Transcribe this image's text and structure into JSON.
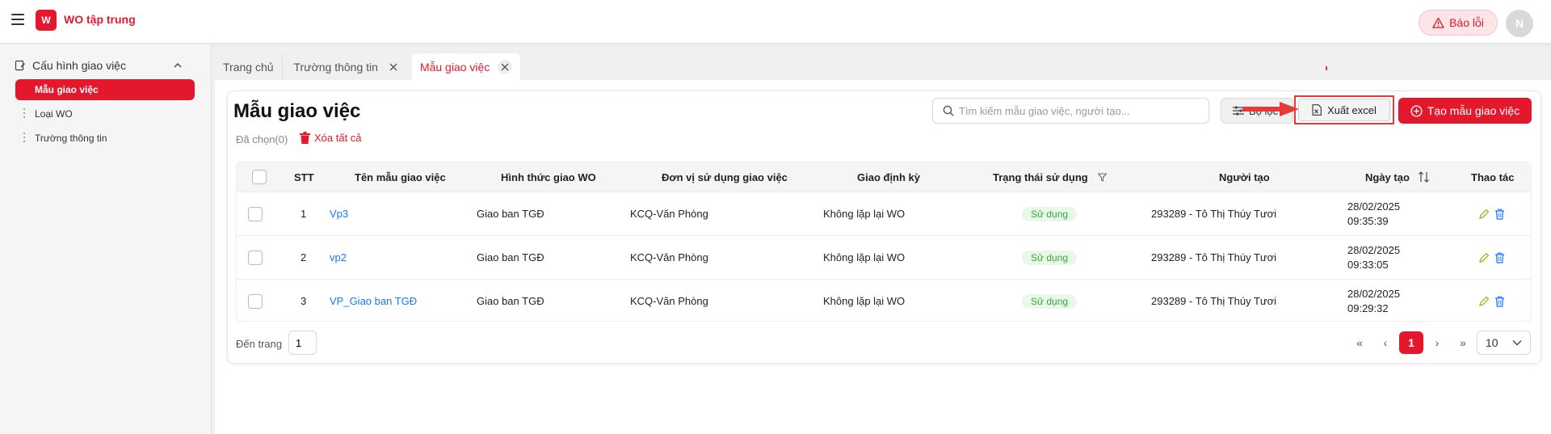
{
  "header": {
    "app_title": "WO tập trung",
    "logo_text": "W",
    "report_label": "Báo lỗi",
    "avatar_initial": "N"
  },
  "sidebar": {
    "group_label": "Cấu hình giao việc",
    "items": [
      {
        "label": "Mẫu giao việc",
        "active": true
      },
      {
        "label": "Loại WO",
        "active": false
      },
      {
        "label": "Trường thông tin",
        "active": false
      }
    ]
  },
  "tabs": [
    {
      "label": "Trang chủ"
    },
    {
      "label": "Trường thông tin"
    },
    {
      "label": "Mẫu giao việc"
    }
  ],
  "page": {
    "title": "Mẫu giao việc",
    "selected_count": "Đã chọn(0)",
    "clear_all": "Xóa tất cả",
    "search_placeholder": "Tìm kiếm mẫu giao việc, người tạo...",
    "filter_label": "Bộ lọc",
    "export_label": "Xuất excel",
    "create_label": "Tạo mẫu giao việc"
  },
  "table": {
    "headers": {
      "stt": "STT",
      "name": "Tên mẫu giao việc",
      "form": "Hình thức giao WO",
      "unit": "Đơn vị sử dụng giao việc",
      "periodic": "Giao định kỳ",
      "status": "Trạng thái sử dụng",
      "creator": "Người tạo",
      "created": "Ngày tạo",
      "actions": "Thao tác"
    },
    "rows": [
      {
        "stt": "1",
        "name": "Vp3",
        "form": "Giao ban TGĐ",
        "unit": "KCQ-Văn Phòng",
        "periodic": "Không lặp lại WO",
        "status": "Sử dụng",
        "creator": "293289 - Tô Thị Thúy Tươi",
        "date": "28/02/2025",
        "time": "09:35:39"
      },
      {
        "stt": "2",
        "name": "vp2",
        "form": "Giao ban TGĐ",
        "unit": "KCQ-Văn Phòng",
        "periodic": "Không lặp lại WO",
        "status": "Sử dụng",
        "creator": "293289 - Tô Thị Thúy Tươi",
        "date": "28/02/2025",
        "time": "09:33:05"
      },
      {
        "stt": "3",
        "name": "VP_Giao ban TGĐ",
        "form": "Giao ban TGĐ",
        "unit": "KCQ-Văn Phòng",
        "periodic": "Không lặp lại WO",
        "status": "Sử dụng",
        "creator": "293289 - Tô Thị Thúy Tươi",
        "date": "28/02/2025",
        "time": "09:29:32"
      }
    ]
  },
  "pagination": {
    "goto_label": "Đến trang",
    "goto_value": "1",
    "first": "«",
    "prev": "‹",
    "current": "1",
    "next": "›",
    "last": "»",
    "page_size": "10"
  },
  "colors": {
    "brand": "#e3182d",
    "link": "#1677ff",
    "status_green": "#39a839",
    "highlight": "#e43a3a"
  }
}
